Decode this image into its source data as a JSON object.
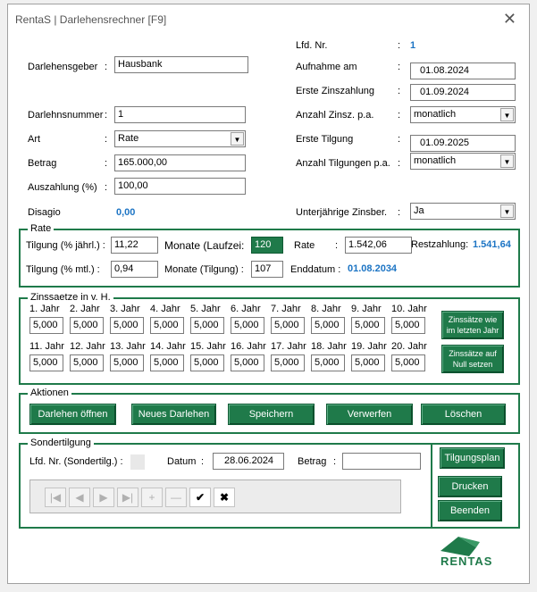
{
  "window": {
    "title": "RentaS | Darlehensrechner [F9]",
    "close": "✕"
  },
  "left": {
    "darlehensgeber_label": "Darlehensgeber",
    "darlehensgeber_value": "Hausbank",
    "darlehensnummer_label": "Darlehnsnummer",
    "darlehensnummer_value": "1",
    "art_label": "Art",
    "art_value": "Rate",
    "betrag_label": "Betrag",
    "betrag_value": "165.000,00",
    "auszahlung_label": "Auszahlung (%)",
    "auszahlung_value": "100,00",
    "disagio_label": "Disagio",
    "disagio_value": "0,00"
  },
  "right": {
    "lfd_label": "Lfd. Nr.",
    "lfd_value": "1",
    "aufnahme_label": "Aufnahme am",
    "aufnahme_value": "01.08.2024",
    "erste_zins_label": "Erste Zinszahlung",
    "erste_zins_value": "01.09.2024",
    "anzahl_zins_label": "Anzahl Zinsz. p.a.",
    "anzahl_zins_value": "monatlich",
    "erste_tilg_label": "Erste Tilgung",
    "erste_tilg_value": "01.09.2025",
    "anzahl_tilg_label": "Anzahl Tilgungen p.a.",
    "anzahl_tilg_value": "monatlich",
    "unterjaehrig_label": "Unterjährige Zinsber.",
    "unterjaehrig_value": "Ja"
  },
  "rate": {
    "title": "Rate",
    "tilg_jahr_label": "Tilgung (% jährl.) :",
    "tilg_jahr_value": "11,22",
    "monate_lauf_label": "Monate (Laufzei:",
    "monate_lauf_value": "120",
    "rate_label": "Rate",
    "rate_value": "1.542,06",
    "rest_label": "Restzahlung:",
    "rest_value": "1.541,64",
    "tilg_mtl_label": "Tilgung (% mtl.) :",
    "tilg_mtl_value": "0,94",
    "monate_tilg_label": "Monate (Tilgung) :",
    "monate_tilg_value": "107",
    "enddatum_label": "Enddatum :",
    "enddatum_value": "01.08.2034"
  },
  "zins": {
    "title": "Zinssaetze in v. H.",
    "row1": [
      {
        "label": "1. Jahr",
        "value": "5,000"
      },
      {
        "label": "2. Jahr",
        "value": "5,000"
      },
      {
        "label": "3. Jahr",
        "value": "5,000"
      },
      {
        "label": "4. Jahr",
        "value": "5,000"
      },
      {
        "label": "5. Jahr",
        "value": "5,000"
      },
      {
        "label": "6. Jahr",
        "value": "5,000"
      },
      {
        "label": "7. Jahr",
        "value": "5,000"
      },
      {
        "label": "8. Jahr",
        "value": "5,000"
      },
      {
        "label": "9. Jahr",
        "value": "5,000"
      },
      {
        "label": "10. Jahr",
        "value": "5,000"
      }
    ],
    "row2": [
      {
        "label": "11. Jahr",
        "value": "5,000"
      },
      {
        "label": "12. Jahr",
        "value": "5,000"
      },
      {
        "label": "13. Jahr",
        "value": "5,000"
      },
      {
        "label": "14. Jahr",
        "value": "5,000"
      },
      {
        "label": "15. Jahr",
        "value": "5,000"
      },
      {
        "label": "16. Jahr",
        "value": "5,000"
      },
      {
        "label": "17. Jahr",
        "value": "5,000"
      },
      {
        "label": "18. Jahr",
        "value": "5,000"
      },
      {
        "label": "19. Jahr",
        "value": "5,000"
      },
      {
        "label": "20. Jahr",
        "value": "5,000"
      }
    ],
    "btn_letzten_1": "Zinssätze wie",
    "btn_letzten_2": "im letzten Jahr",
    "btn_null_1": "Zinssätze auf",
    "btn_null_2": "Null setzen"
  },
  "aktionen": {
    "title": "Aktionen",
    "oeffnen": "Darlehen öffnen",
    "neu": "Neues Darlehen",
    "speichern": "Speichern",
    "verwerfen": "Verwerfen",
    "loeschen": "Löschen"
  },
  "sonder": {
    "title": "Sondertilgung",
    "lfd_label": "Lfd. Nr. (Sondertilg.) :",
    "datum_label": "Datum",
    "datum_value": "28.06.2024",
    "betrag_label": "Betrag",
    "betrag_value": "",
    "tilgungsplan": "Tilgungsplan",
    "drucken": "Drucken",
    "beenden": "Beenden"
  },
  "nav": {
    "first": "|◀",
    "prev": "◀",
    "next": "▶",
    "last": "▶|",
    "add": "+",
    "del": "—",
    "ok": "✔",
    "cancel": "✖"
  },
  "logo": "RENTAS",
  "colors": {
    "accent": "#1f7a4a",
    "value_blue": "#1c74c4"
  }
}
